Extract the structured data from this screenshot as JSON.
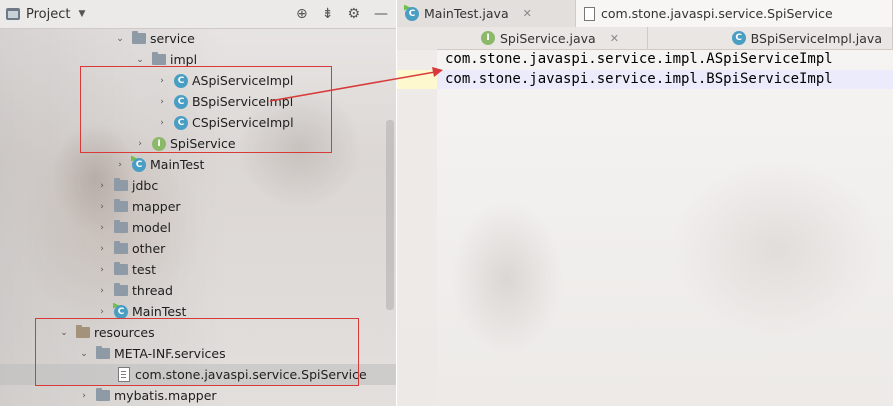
{
  "project_panel": {
    "title": "Project",
    "tree": [
      {
        "label": "service",
        "kind": "folder",
        "expanded": true
      },
      {
        "label": "impl",
        "kind": "folder",
        "expanded": true
      },
      {
        "label": "ASpiServiceImpl",
        "kind": "class"
      },
      {
        "label": "BSpiServiceImpl",
        "kind": "class"
      },
      {
        "label": "CSpiServiceImpl",
        "kind": "class"
      },
      {
        "label": "SpiService",
        "kind": "interface"
      },
      {
        "label": "MainTest",
        "kind": "main-class"
      },
      {
        "label": "jdbc",
        "kind": "folder"
      },
      {
        "label": "mapper",
        "kind": "folder"
      },
      {
        "label": "model",
        "kind": "folder"
      },
      {
        "label": "other",
        "kind": "folder"
      },
      {
        "label": "test",
        "kind": "folder"
      },
      {
        "label": "thread",
        "kind": "folder"
      },
      {
        "label": "MainTest",
        "kind": "main-class"
      },
      {
        "label": "resources",
        "kind": "resources-folder",
        "expanded": true
      },
      {
        "label": "META-INF.services",
        "kind": "folder",
        "expanded": true
      },
      {
        "label": "com.stone.javaspi.service.SpiService",
        "kind": "file",
        "selected": true
      },
      {
        "label": "mybatis.mapper",
        "kind": "folder"
      }
    ]
  },
  "editor": {
    "tabs_row1": [
      {
        "label": "MainTest.java",
        "icon": "main-class-icon"
      },
      {
        "label": "com.stone.javaspi.service.SpiService",
        "icon": "text-file-icon",
        "active": true
      }
    ],
    "tabs_row2": [
      {
        "label": "SpiService.java",
        "icon": "interface-icon"
      },
      {
        "label": "BSpiServiceImpl.java",
        "icon": "class-icon"
      }
    ],
    "lines": [
      "com.stone.javaspi.service.impl.ASpiServiceImpl",
      "com.stone.javaspi.service.impl.BSpiServiceImpl"
    ]
  },
  "colors": {
    "highlight_box": "#d83a3a",
    "class_icon": "#4a9ec4",
    "interface_icon": "#8cb86a"
  }
}
